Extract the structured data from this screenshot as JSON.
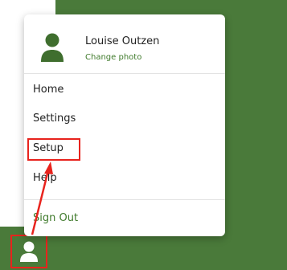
{
  "colors": {
    "background_green": "#4a7a3a",
    "accent_green": "#3f7a2b",
    "annotation_red": "#e8231d",
    "text_dark": "#222222"
  },
  "user_menu": {
    "profile": {
      "name": "Louise Outzen",
      "change_photo_label": "Change photo",
      "avatar_icon": "person-icon"
    },
    "items": [
      {
        "label": "Home"
      },
      {
        "label": "Settings"
      },
      {
        "label": "Setup"
      },
      {
        "label": "Help"
      }
    ],
    "sign_out_label": "Sign Out"
  },
  "bottom_nav": {
    "avatar_icon": "person-icon"
  },
  "annotation": {
    "highlighted_item": "Setup"
  }
}
